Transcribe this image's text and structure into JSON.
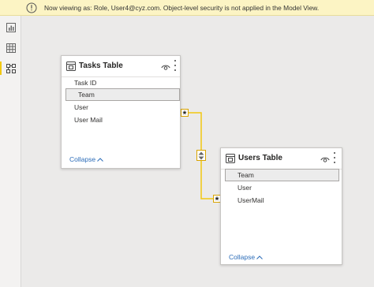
{
  "banner": {
    "icon": "warning-icon",
    "text": "Now viewing as: Role, User4@cyz.com. Object-level security is not applied in the Model View."
  },
  "rail": {
    "items": [
      {
        "icon": "report-view-icon",
        "active": false
      },
      {
        "icon": "data-view-icon",
        "active": false
      },
      {
        "icon": "model-view-icon",
        "active": true
      }
    ]
  },
  "tables": [
    {
      "title": "Tasks Table",
      "fields": [
        "Task ID",
        "Team",
        "User",
        "User Mail"
      ],
      "selected_field": "Team",
      "collapse_label": "Collapse"
    },
    {
      "title": "Users Table",
      "fields": [
        "Team",
        "User",
        "UserMail"
      ],
      "selected_field": "Team",
      "collapse_label": "Collapse"
    }
  ],
  "relationship": {
    "from_cardinality": "*",
    "to_cardinality": "*",
    "cross_filter": "both",
    "line_color": "#f2c811"
  },
  "colors": {
    "banner_bg": "#fcf4c4",
    "canvas_bg": "#ebeae9",
    "accent": "#f2c811",
    "link": "#2b6cb8"
  }
}
